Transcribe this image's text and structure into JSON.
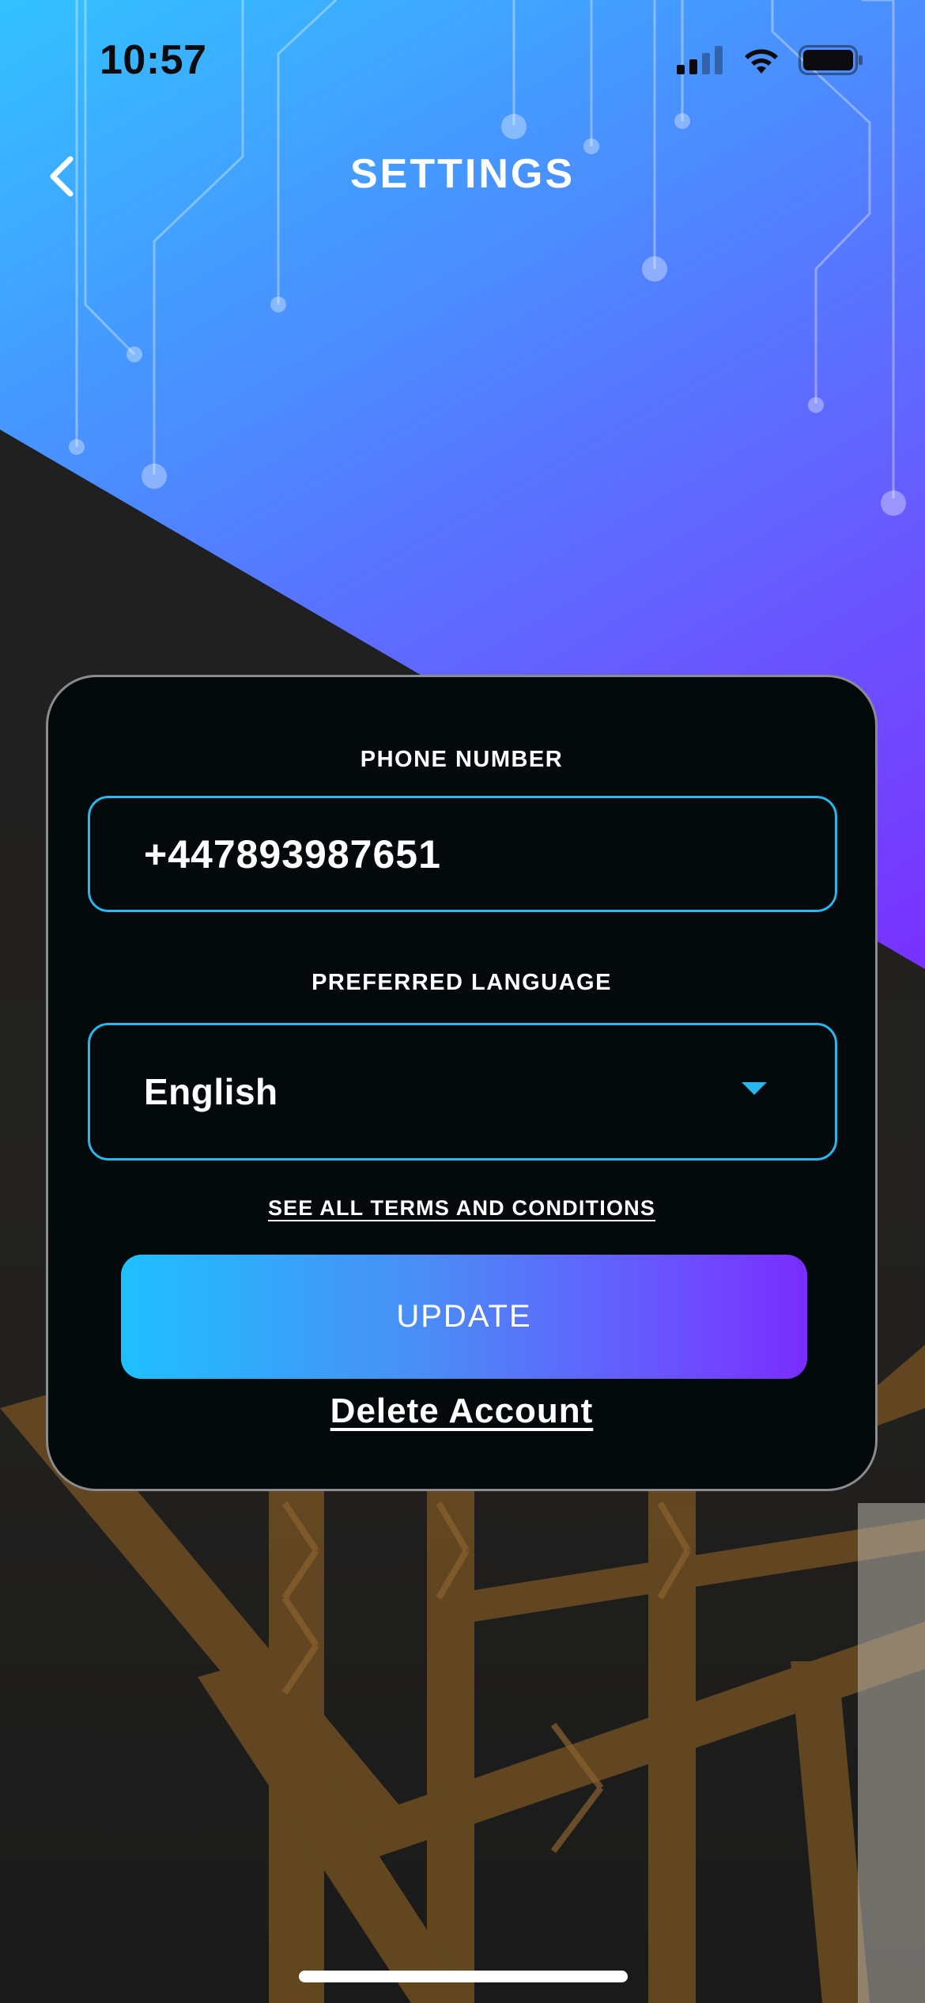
{
  "status_bar": {
    "time": "10:57"
  },
  "header": {
    "title": "SETTINGS"
  },
  "form": {
    "phone_label": "PHONE NUMBER",
    "phone_value": "+447893987651",
    "language_label": "PREFERRED LANGUAGE",
    "language_value": "English",
    "terms_link": "SEE ALL TERMS AND CONDITIONS",
    "update_label": "UPDATE",
    "delete_label": "Delete Account"
  },
  "icons": {
    "back": "chevron-left-icon",
    "dropdown": "caret-down-icon",
    "signal": "cellular-signal-icon",
    "wifi": "wifi-icon",
    "battery": "battery-icon"
  },
  "colors": {
    "accent": "#2ab7ee",
    "gradient_start": "#1fc0ff",
    "gradient_end": "#7a2dff",
    "card_bg": "#040a0c"
  }
}
